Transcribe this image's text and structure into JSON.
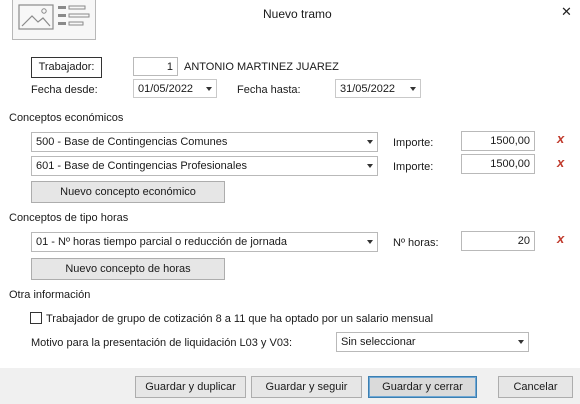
{
  "window": {
    "title": "Nuevo tramo",
    "close_glyph": "✕"
  },
  "header": {
    "trabajador_button": "Trabajador:",
    "trabajador_id": "1",
    "trabajador_name": "ANTONIO MARTINEZ JUAREZ",
    "fecha_desde_label": "Fecha desde:",
    "fecha_desde_value": "01/05/2022",
    "fecha_hasta_label": "Fecha hasta:",
    "fecha_hasta_value": "31/05/2022"
  },
  "economicos": {
    "title": "Conceptos económicos",
    "rows": [
      {
        "concepto": "500 - Base de Contingencias Comunes",
        "importe_label": "Importe:",
        "importe": "1500,00",
        "delete": "x"
      },
      {
        "concepto": "601 - Base de Contingencias Profesionales",
        "importe_label": "Importe:",
        "importe": "1500,00",
        "delete": "x"
      }
    ],
    "new_button": "Nuevo concepto económico"
  },
  "horas": {
    "title": "Conceptos de tipo horas",
    "rows": [
      {
        "concepto": "01 - Nº horas tiempo parcial o reducción de jornada",
        "horas_label": "Nº horas:",
        "horas": "20",
        "delete": "x"
      }
    ],
    "new_button": "Nuevo concepto de horas"
  },
  "otra": {
    "title": "Otra información",
    "checkbox_label": "Trabajador de grupo de cotización 8 a 11 que ha optado por un salario mensual",
    "checkbox_checked": false,
    "motivo_label": "Motivo para la presentación de liquidación L03 y V03:",
    "motivo_value": "Sin seleccionar"
  },
  "footer": {
    "guardar_duplicar": "Guardar y duplicar",
    "guardar_seguir": "Guardar y seguir",
    "guardar_cerrar": "Guardar y cerrar",
    "cancelar": "Cancelar"
  },
  "colors": {
    "delete_accent": "#c0392b",
    "primary_border": "#3c7fb1"
  },
  "icons": [
    "form-icon",
    "close-icon",
    "dropdown-arrow-icon",
    "delete-icon",
    "checkbox-icon"
  ]
}
